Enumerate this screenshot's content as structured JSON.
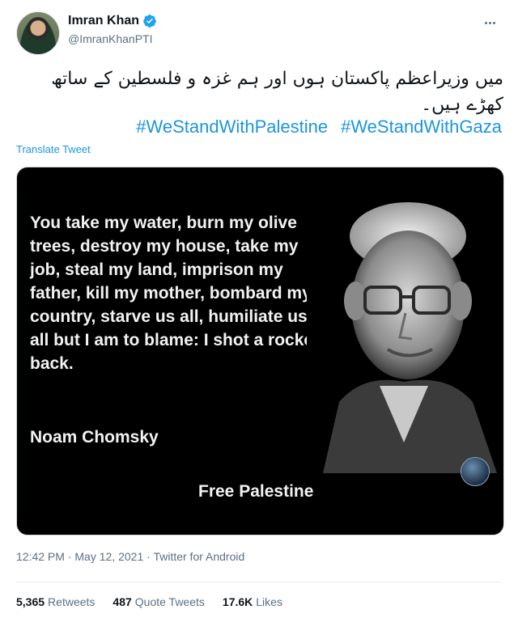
{
  "tweet": {
    "author": {
      "display_name": "Imran Khan",
      "handle": "@ImranKhanPTI",
      "verified": true
    },
    "text_urdu": "میں وزیراعظم پاکستان ہوں اور ہم غزہ و فلسطین کے ساتھ کھڑے ہیں۔",
    "hashtags": [
      "#WeStandWithPalestine",
      "#WeStandWithGaza"
    ],
    "translate_label": "Translate Tweet",
    "media": {
      "quote_text": "You take my water, burn my olive trees, destroy my house, take my job, steal my land, imprison my father, kill my mother, bombard my country, starve us all, humiliate us all but I am to blame: I shot a rocket back.",
      "author": "Noam Chomsky",
      "footer": "Free Palestine"
    },
    "time": "12:42 PM",
    "date": "May 12, 2021",
    "source": "Twitter for Android",
    "stats": {
      "retweets_count": "5,365",
      "retweets_label": "Retweets",
      "quote_tweets_count": "487",
      "quote_tweets_label": "Quote Tweets",
      "likes_count": "17.6K",
      "likes_label": "Likes"
    }
  },
  "colors": {
    "link": "#1b95e0",
    "verified": "#1da1f2",
    "secondary_text": "#5b7083"
  },
  "icons": {
    "verified": "verified-badge-icon",
    "more": "more-options-icon"
  }
}
